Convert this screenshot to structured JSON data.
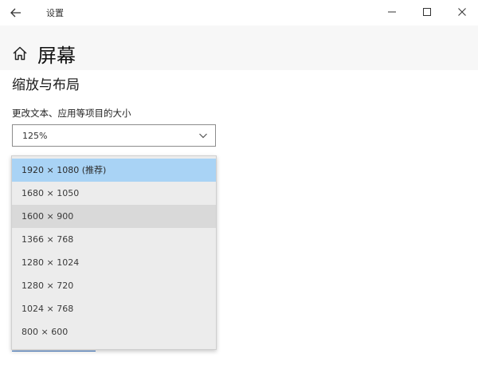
{
  "window": {
    "title": "设置",
    "icons": {
      "back": "arrow-left-icon",
      "minimize": "minimize-icon",
      "maximize": "maximize-icon",
      "close": "close-icon"
    }
  },
  "header": {
    "title": "屏幕",
    "icon": "home-icon"
  },
  "scaling": {
    "section_title": "缩放与布局",
    "label": "更改文本、应用等项目的大小",
    "selected_value": "125%"
  },
  "resolution_dropdown": {
    "options": [
      "1920 × 1080 (推荐)",
      "1680 × 1050",
      "1600 × 900",
      "1366 × 768",
      "1280 × 1024",
      "1280 × 720",
      "1024 × 768",
      "800 × 600"
    ],
    "selected_index": 0,
    "hovered_index": 2
  },
  "colors": {
    "selected": "#a9d3f5",
    "hover": "#d9d9d9",
    "dropdown_bg": "#ececec"
  }
}
